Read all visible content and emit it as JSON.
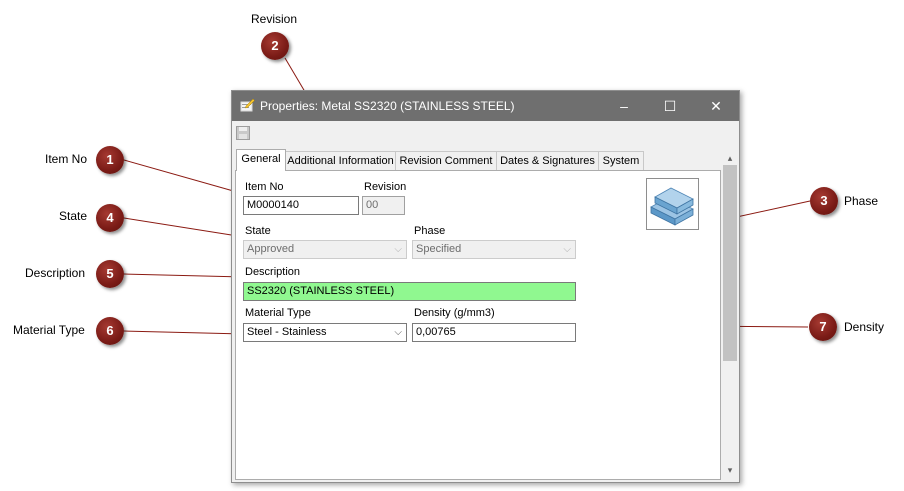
{
  "callouts": {
    "c1": {
      "num": "1",
      "label": "Item No"
    },
    "c2": {
      "num": "2",
      "label": "Revision"
    },
    "c3": {
      "num": "3",
      "label": "Phase"
    },
    "c4": {
      "num": "4",
      "label": "State"
    },
    "c5": {
      "num": "5",
      "label": "Description"
    },
    "c6": {
      "num": "6",
      "label": "Material Type"
    },
    "c7": {
      "num": "7",
      "label": "Density"
    }
  },
  "window": {
    "title": "Properties: Metal SS2320 (STAINLESS STEEL)",
    "controls": {
      "minimize": "–",
      "maximize": "☐",
      "close": "✕"
    }
  },
  "tabs": [
    "General",
    "Additional Information",
    "Revision Comment",
    "Dates & Signatures",
    "System"
  ],
  "form": {
    "item_no": {
      "label": "Item No",
      "value": "M0000140"
    },
    "revision": {
      "label": "Revision",
      "value": "00"
    },
    "state": {
      "label": "State",
      "value": "Approved"
    },
    "phase": {
      "label": "Phase",
      "value": "Specified"
    },
    "description": {
      "label": "Description",
      "value": "SS2320 (STAINLESS STEEL)"
    },
    "material_type": {
      "label": "Material Type",
      "value": "Steel - Stainless"
    },
    "density": {
      "label": "Density (g/mm3)",
      "value": "0,00765"
    }
  },
  "icons": {
    "save": "save-icon",
    "metal": "metal-bars-icon",
    "properties": "properties-icon"
  },
  "colors": {
    "badge": "#7a1b16",
    "callout_line": "#8b1a12",
    "titlebar": "#6f6f6f",
    "description_bg": "#90f890"
  }
}
